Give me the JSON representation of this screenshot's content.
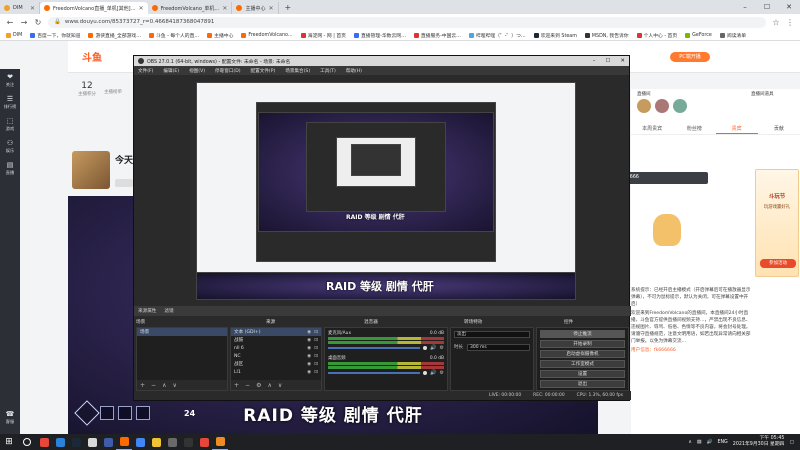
{
  "browser": {
    "tabs": [
      {
        "label": "DIM",
        "color": "#f1a02b",
        "active": false
      },
      {
        "label": "FreedomVolcano直播_单机[其他]…",
        "color": "#ff6a00",
        "active": true
      },
      {
        "label": "FreedomVolcano_单机…",
        "color": "#ff6a00",
        "active": false
      },
      {
        "label": "主播中心",
        "color": "#ff6a00",
        "active": false
      }
    ],
    "url": "www.douyu.com/85373727_r=0.46684187368047891",
    "bookmarks": [
      {
        "label": "DIM",
        "color": "#f1a02b"
      },
      {
        "label": "百度一下，你就知道",
        "color": "#3a6cf0"
      },
      {
        "label": "游侠直播_全部游戏…",
        "color": "#ff6a00"
      },
      {
        "label": "斗鱼 - 每个人的直…",
        "color": "#ff6a00"
      },
      {
        "label": "主播中心",
        "color": "#ff6a00"
      },
      {
        "label": "FreedomVolcano…",
        "color": "#ff6a00"
      },
      {
        "label": "海淀网 - 网 | 首页",
        "color": "#d33"
      },
      {
        "label": "直播管理-华数云网…",
        "color": "#3a6cf0"
      },
      {
        "label": "直播服务-中国云…",
        "color": "#d33"
      },
      {
        "label": "哔哩哔哩（゜-゜）つ…",
        "color": "#4aa7e0"
      },
      {
        "label": "欢迎来到 Steam",
        "color": "#1b2838"
      },
      {
        "label": "MSDN, 我告诉你",
        "color": "#333"
      },
      {
        "label": "个人中心 - 首页",
        "color": "#d33"
      },
      {
        "label": "GeForce",
        "color": "#76b900"
      },
      {
        "label": "阅读清单",
        "color": "#666"
      }
    ]
  },
  "douyu": {
    "logo_text": "斗鱼",
    "follow_count": "12",
    "follow_label": "主播积分",
    "fans_label": "主播榜单",
    "streamer_title": "今天",
    "pc_button": "PC端开播",
    "sidebar": [
      {
        "icon": "❤",
        "label": "关注",
        "name": "follow-icon"
      },
      {
        "icon": "☰",
        "label": "排行榜",
        "name": "rank-icon"
      },
      {
        "icon": "⬚",
        "label": "游戏",
        "name": "game-icon"
      },
      {
        "icon": "⚇",
        "label": "娱乐",
        "name": "entertain-icon"
      },
      {
        "icon": "▤",
        "label": "直播",
        "name": "live-icon"
      }
    ],
    "bottom_sidebar_label": "客服",
    "right_top_labels": [
      "直播间",
      "直播间道具"
    ],
    "right_tabs": [
      "本周贵宾",
      "粉丝榜",
      "贵宾",
      "贡献"
    ],
    "promo_title": "斗玩节",
    "promo_sub": "玩游戏赢好礼",
    "promo_button": "参加活动",
    "notice_1": "系统提示：已经开启主播模式（开启弹幕后可在播放器显示弹幕），不可为鼠标提示，默认为关闭，可在弹幕设置中开启）",
    "notice_2": "欢迎来到FreedomVolcano的直播间，本直播间24小时直播，斗鱼官方提供直播间视频支持…，严禁出现不良信息、违规图片、辱骂、低俗、色情等不良内容，将会封号处理。请遵守直播规范，注意文明用语，如若出现异常请向相关部门举报。以免为弹幕交流…",
    "notice_3": "用户信息：fk666666",
    "tooltip": "小伊伊：fk666666"
  },
  "video": {
    "caption": "RAID 等级 剧情 代肝",
    "hud_number": "24"
  },
  "obs": {
    "title": "OBS 27.0.1 (64-bit, windows) - 配置文件: 未命名 - 场景: 未命名",
    "menu": [
      "文件(F)",
      "编辑(E)",
      "视图(V)",
      "停靠窗口(D)",
      "配置文件(P)",
      "场景集合(S)",
      "工具(T)",
      "帮助(H)"
    ],
    "preview_caption": "RAID 等级 剧情 代肝",
    "split_labels": [
      "来源属性",
      "滤镜"
    ],
    "dock_headers": [
      "场景",
      "来源",
      "混音器",
      "转场特效",
      "控件"
    ],
    "scenes": [
      "场景"
    ],
    "sources": [
      "文本 (GDI+)",
      "战鼓",
      "nll 6",
      "NC",
      "战区",
      "Ll1"
    ],
    "mixer": [
      {
        "name": "麦克风/Aux",
        "db": "0.0 dB"
      },
      {
        "name": "桌面音频",
        "db": "0.0 dB"
      }
    ],
    "transition_value": "淡出",
    "duration_label": "时长",
    "duration_value": "300 ms",
    "controls": [
      "停止推流",
      "开始录制",
      "启动虚拟摄像机",
      "工作室模式",
      "设置",
      "退出"
    ],
    "status": [
      "LIVE: 00:00:00",
      "REC: 00:00:00",
      "CPU: 1.3%, 60.00 fps"
    ]
  },
  "taskbar": {
    "apps": [
      {
        "color": "#e8463a"
      },
      {
        "color": "#2a83d8"
      },
      {
        "color": "#1b2838"
      },
      {
        "color": "#d9d9d9"
      },
      {
        "color": "#3f5ca8"
      },
      {
        "color": "#ff6a00"
      },
      {
        "color": "#4285f4"
      },
      {
        "color": "#f1c232"
      },
      {
        "color": "#6a6a6a"
      },
      {
        "color": "#333333"
      },
      {
        "color": "#e8463a"
      },
      {
        "color": "#f08a24"
      }
    ],
    "lang": "ENG",
    "time": "下午 05:45",
    "date": "2021年9月30日 星期四"
  }
}
